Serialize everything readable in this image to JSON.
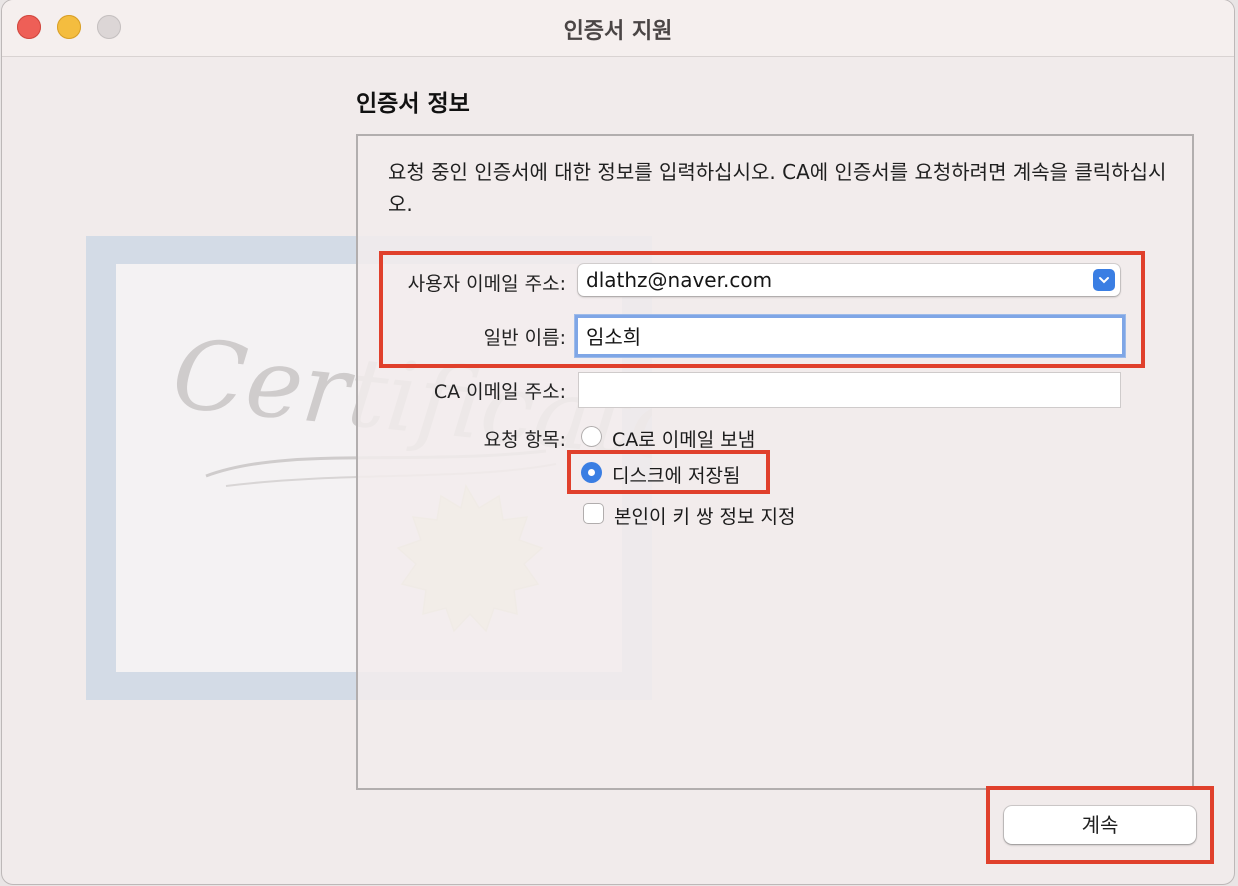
{
  "window": {
    "title": "인증서 지원"
  },
  "section": {
    "title": "인증서 정보",
    "description": "요청 중인 인증서에 대한 정보를 입력하십시오. CA에 인증서를 요청하려면 계속을 클릭하십시오."
  },
  "artwork": {
    "script_text": "Certificate"
  },
  "form": {
    "user_email_label": "사용자 이메일 주소:",
    "user_email_value": "dlathz@naver.com",
    "common_name_label": "일반 이름:",
    "common_name_value": "임소희",
    "ca_email_label": "CA 이메일 주소:",
    "ca_email_value": "",
    "request_label": "요청 항목:",
    "option_email_ca": "CA로 이메일 보냄",
    "option_save_disk": "디스크에 저장됨",
    "option_specify_keypair": "본인이 키 쌍 정보 지정"
  },
  "buttons": {
    "continue": "계속"
  },
  "colors": {
    "accent": "#3a7ee3",
    "highlight": "#e0402c",
    "focus_ring": "#7fa6e6"
  }
}
